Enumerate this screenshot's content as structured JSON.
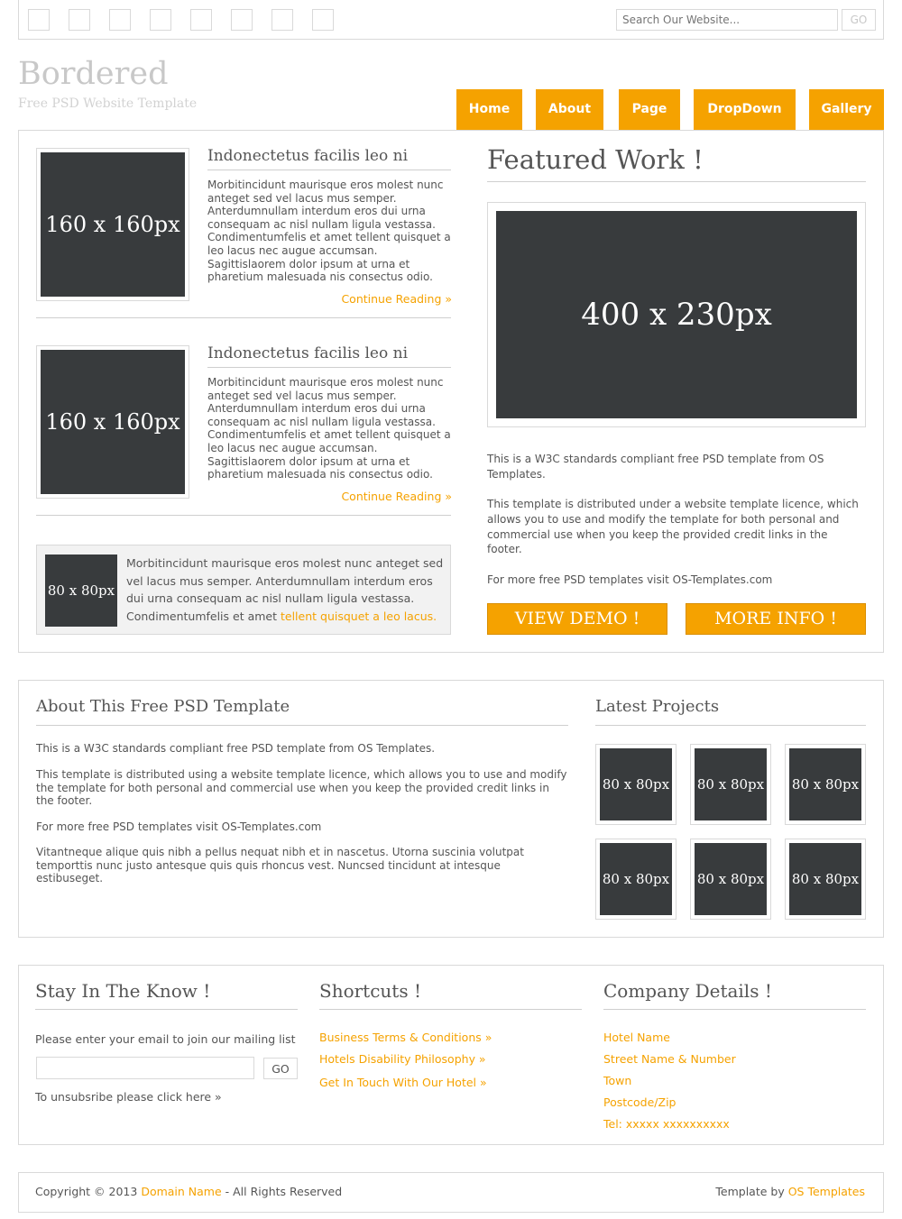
{
  "topbar": {
    "social_icons": [
      "social-icon-1",
      "social-icon-2",
      "social-icon-3",
      "social-icon-4",
      "social-icon-5",
      "social-icon-6",
      "social-icon-7",
      "social-icon-8"
    ],
    "search_placeholder": "Search Our Website...",
    "search_button": "GO"
  },
  "brand": {
    "title": "Bordered",
    "tagline": "Free PSD Website Template"
  },
  "nav": {
    "items": [
      "Home",
      "About",
      "Page",
      "DropDown",
      "Gallery"
    ]
  },
  "colors": {
    "accent": "#f5a200",
    "placeholder_bg": "#383b3d",
    "border": "#d9d9d9"
  },
  "posts": [
    {
      "image_label": "160 x 160px",
      "title": "Indonectetus facilis leo ni",
      "body": "Morbitincidunt maurisque eros molest nunc anteget sed vel lacus mus semper. Anterdumnullam interdum eros dui urna consequam ac nisl nullam ligula vestassa. Condimentumfelis et amet tellent quisquet a leo lacus nec augue accumsan. Sagittislaorem dolor ipsum at urna et pharetium malesuada nis consectus odio.",
      "more": "Continue Reading »"
    },
    {
      "image_label": "160 x 160px",
      "title": "Indonectetus facilis leo ni",
      "body": "Morbitincidunt maurisque eros molest nunc anteget sed vel lacus mus semper. Anterdumnullam interdum eros dui urna consequam ac nisl nullam ligula vestassa. Condimentumfelis et amet tellent quisquet a leo lacus nec augue accumsan. Sagittislaorem dolor ipsum at urna et pharetium malesuada nis consectus odio.",
      "more": "Continue Reading »"
    }
  ],
  "callout": {
    "image_label": "80 x 80px",
    "text": "Morbitincidunt maurisque eros molest nunc anteget sed vel lacus mus semper. Anterdumnullam interdum eros dui urna consequam ac nisl nullam ligula vestassa. Condimentumfelis et amet ",
    "link": "tellent quisquet a leo lacus."
  },
  "featured": {
    "title": "Featured Work !",
    "image_label": "400 x 230px",
    "paragraphs": [
      "This is a W3C standards compliant free PSD template from OS Templates.",
      "This template is distributed under a website template licence, which allows you to use and modify the template for both personal and commercial use when you keep the provided credit links in the footer.",
      "For more free PSD templates visit OS-Templates.com"
    ],
    "demo_button": "VIEW DEMO !",
    "info_button": "MORE INFO !"
  },
  "about": {
    "title": "About This Free PSD Template",
    "paragraphs": [
      "This is a W3C standards compliant free PSD template from OS Templates.",
      "This template is distributed using a website template licence, which allows you to use and modify the template for both personal and commercial use when you keep the provided credit links in the footer.",
      "For more free PSD templates visit OS-Templates.com",
      "Vitantneque alique quis nibh a pellus nequat nibh et in nascetus. Utorna suscinia volutpat temporttis nunc justo antesque quis quis rhoncus vest. Nuncsed tincidunt at intesque estibuseget."
    ]
  },
  "projects": {
    "title": "Latest Projects",
    "items": [
      "80 x 80px",
      "80 x 80px",
      "80 x 80px",
      "80 x 80px",
      "80 x 80px",
      "80 x 80px"
    ]
  },
  "newsletter": {
    "title": "Stay In The Know !",
    "intro": "Please enter your email to join our mailing list",
    "button": "GO",
    "unsubscribe": "To unsubsribe please click here »"
  },
  "shortcuts": {
    "title": "Shortcuts !",
    "links": [
      "Business Terms & Conditions »",
      "Hotels Disability Philosophy »",
      "Get In Touch With Our Hotel »"
    ]
  },
  "company": {
    "title": "Company Details !",
    "lines": [
      "Hotel Name",
      "Street Name & Number",
      "Town",
      "Postcode/Zip",
      "Tel: xxxxx xxxxxxxxxx"
    ]
  },
  "footer": {
    "copyright_prefix": "Copyright © 2013 ",
    "domain_link": "Domain Name",
    "copyright_suffix": " - All Rights Reserved",
    "template_prefix": "Template by ",
    "template_link": "OS Templates"
  }
}
